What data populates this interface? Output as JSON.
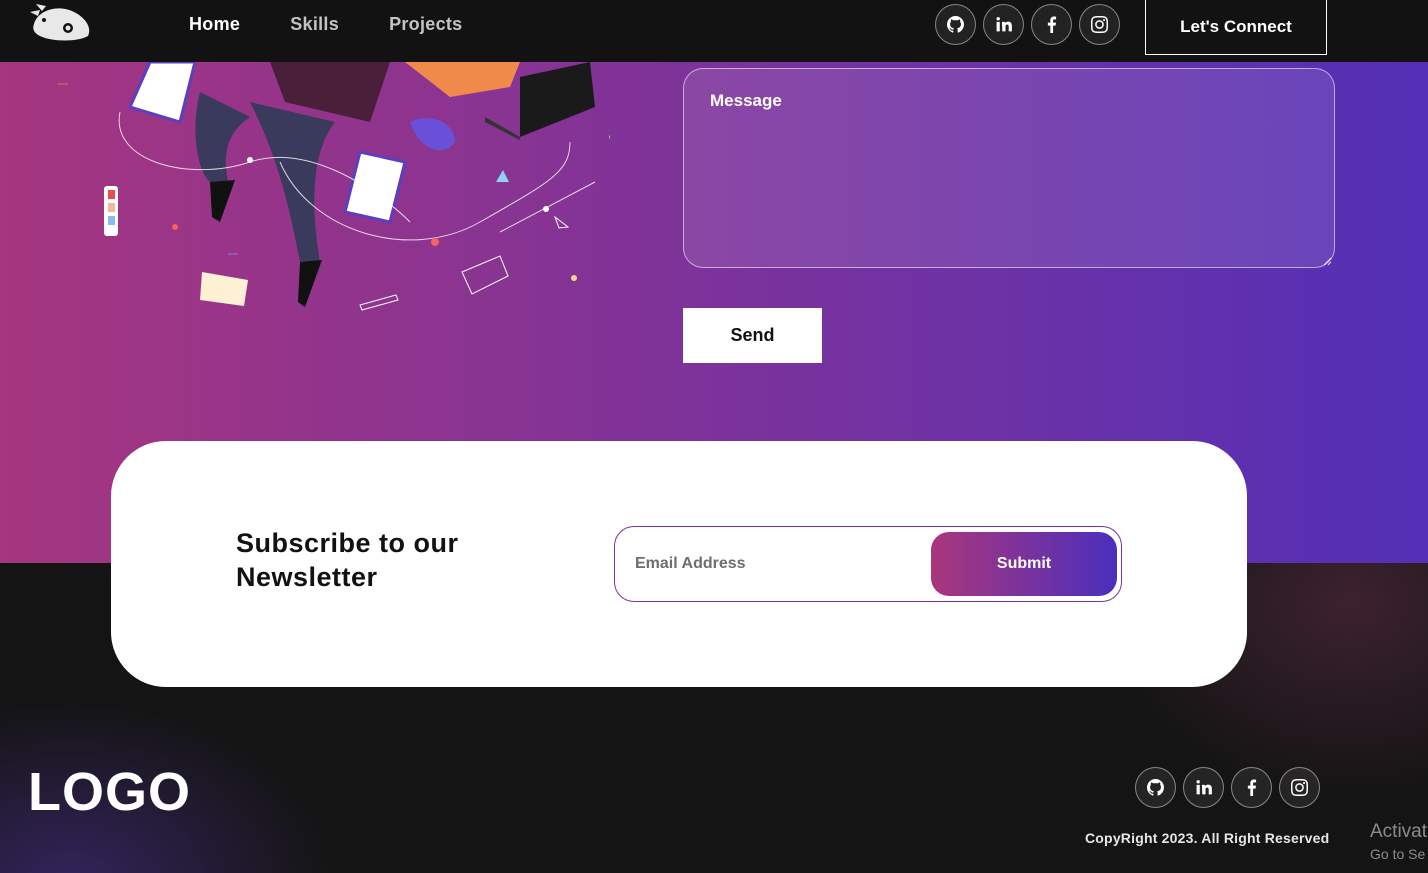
{
  "nav": {
    "links": [
      {
        "label": "Home",
        "active": true
      },
      {
        "label": "Skills",
        "active": false
      },
      {
        "label": "Projects",
        "active": false
      }
    ],
    "socials": [
      "github-icon",
      "linkedin-icon",
      "facebook-icon",
      "instagram-icon"
    ],
    "connect_label": "Let's Connect"
  },
  "contact": {
    "message_placeholder": "Message",
    "send_label": "Send"
  },
  "newsletter": {
    "title": "Subscribe to our Newsletter",
    "email_placeholder": "Email Address",
    "submit_label": "Submit"
  },
  "footer": {
    "logo": "LOGO",
    "socials": [
      "github-icon",
      "linkedin-icon",
      "facebook-icon",
      "instagram-icon"
    ],
    "copyright": "CopyRight 2023. All Right Reserved"
  },
  "os_watermark": {
    "line1": "Activat",
    "line2": "Go to Se"
  },
  "colors": {
    "gradient_start": "#aa367c",
    "gradient_end": "#4a2fbd",
    "background": "#121212"
  }
}
